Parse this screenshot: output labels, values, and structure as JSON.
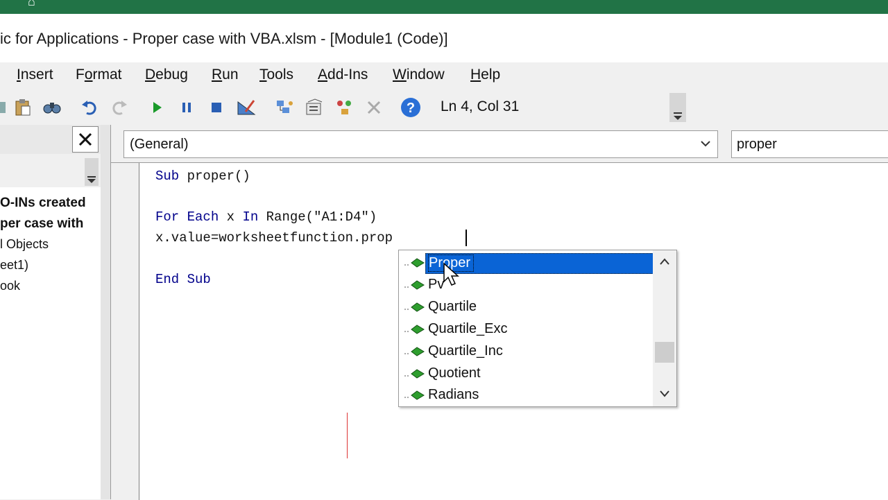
{
  "window": {
    "title": "ic for Applications - Proper case with VBA.xlsm - [Module1 (Code)]"
  },
  "menu": {
    "items": [
      {
        "label": "Insert",
        "underline": "I",
        "rest": "nsert"
      },
      {
        "label": "Format",
        "underline": "o",
        "pre": "F",
        "rest": "rmat"
      },
      {
        "label": "Debug",
        "underline": "D",
        "rest": "ebug"
      },
      {
        "label": "Run",
        "underline": "R",
        "rest": "un"
      },
      {
        "label": "Tools",
        "underline": "T",
        "rest": "ools"
      },
      {
        "label": "Add-Ins",
        "underline": "A",
        "rest": "dd-Ins"
      },
      {
        "label": "Window",
        "underline": "W",
        "rest": "indow"
      },
      {
        "label": "Help",
        "underline": "H",
        "rest": "elp"
      }
    ]
  },
  "toolbar": {
    "status": "Ln 4, Col 31"
  },
  "project": {
    "tree": [
      "O-INs created",
      "per case with",
      "l Objects",
      "eet1)",
      "ook"
    ]
  },
  "code": {
    "object_combo": "(General)",
    "procedure_combo": "proper",
    "lines": {
      "l1_kw": "Sub",
      "l1_rest": " proper()",
      "l3_kw1": "For Each",
      "l3_mid": " x ",
      "l3_kw2": "In",
      "l3_rest": " Range(\"A1:D4\")",
      "l4": "x.value=worksheetfunction.prop",
      "l6": "End Sub"
    }
  },
  "autocomplete": {
    "items": [
      "Proper",
      "Pv",
      "Quartile",
      "Quartile_Exc",
      "Quartile_Inc",
      "Quotient",
      "Radians"
    ],
    "selected": "Proper"
  },
  "colors": {
    "selection": "#0a64d6",
    "excel_green": "#217346"
  }
}
